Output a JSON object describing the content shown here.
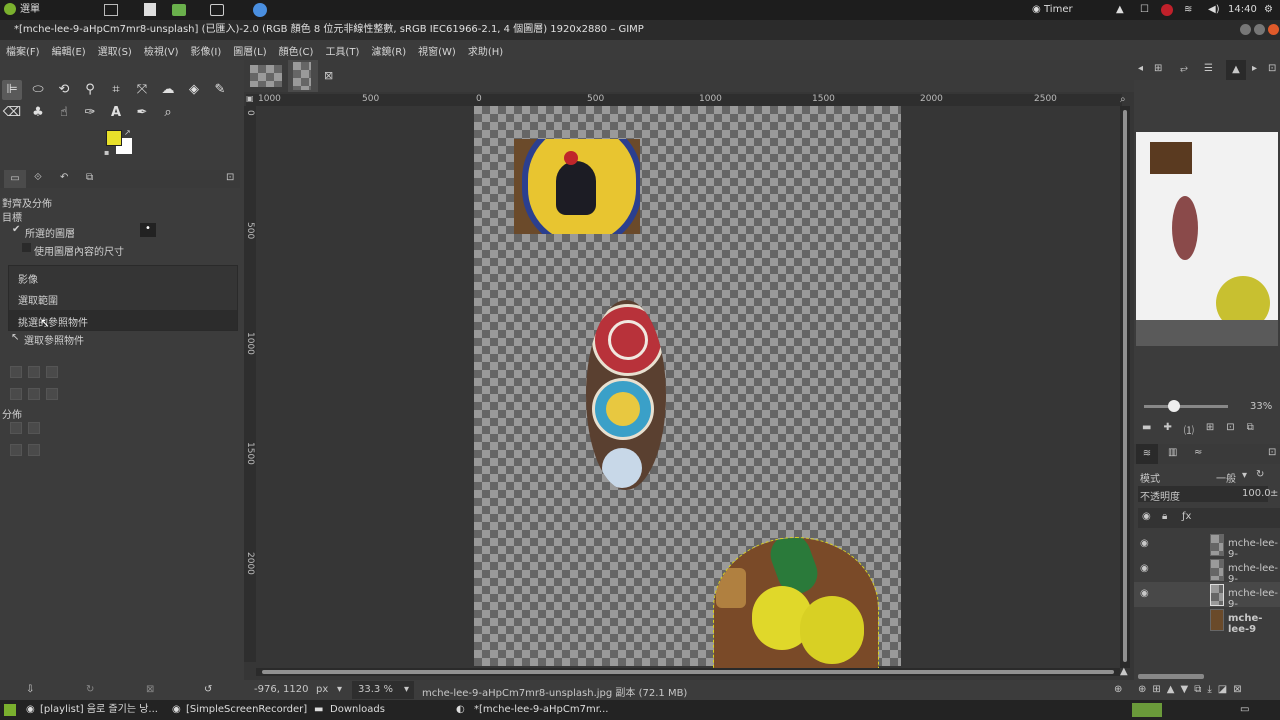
{
  "sysbar": {
    "menu_label": "選單",
    "timer": "Timer",
    "clock": "14:40"
  },
  "window": {
    "title": "*[mche-lee-9-aHpCm7mr8-unsplash] (已匯入)-2.0 (RGB 顏色 8 位元非線性整數, sRGB IEC61966-2.1, 4 個圖層) 1920x2880 – GIMP"
  },
  "menu": [
    "檔案(F)",
    "編輯(E)",
    "選取(S)",
    "檢視(V)",
    "影像(I)",
    "圖層(L)",
    "顏色(C)",
    "工具(T)",
    "濾鏡(R)",
    "視窗(W)",
    "求助(H)"
  ],
  "align_panel": {
    "heading": "對齊及分佈",
    "target_label": "目標",
    "selected_layers": "所選的圖層",
    "use_layer_contents": "使用圖層內容的尺寸",
    "dropdown_items": [
      "影像",
      "選取範圍",
      "挑選的參照物件"
    ],
    "pick_reference": "選取參照物件",
    "distribute_label": "分佈"
  },
  "rulers": {
    "h_ticks": [
      "1000",
      "500",
      "0",
      "500",
      "1000",
      "1500",
      "2000",
      "2500"
    ],
    "v_ticks": [
      "0",
      "500",
      "1000",
      "1500",
      "2000"
    ]
  },
  "statusbar": {
    "coords": "-976, 1120",
    "unit": "px",
    "zoom": "33.3 %",
    "message": "mche-lee-9-aHpCm7mr8-unsplash.jpg 副本 (72.1 MB)"
  },
  "navigator": {
    "zoom_label": "33%",
    "zoom_fraction": 0.333
  },
  "layers_panel": {
    "mode_label": "模式",
    "mode_value": "一般",
    "opacity_label": "不透明度",
    "opacity_value": "100.0",
    "layers": [
      "mche-lee-9-",
      "mche-lee-9-",
      "mche-lee-9-",
      "mche-lee-9"
    ]
  },
  "taskbar": {
    "items": [
      "[playlist] 음로 즐기는 낭...",
      "[SimpleScreenRecorder]",
      "Downloads",
      "*[mche-lee-9-aHpCm7mr..."
    ]
  },
  "colors": {
    "foreground": "#e8e02a",
    "background": "#ffffff",
    "accent": "#d6d6d6"
  }
}
